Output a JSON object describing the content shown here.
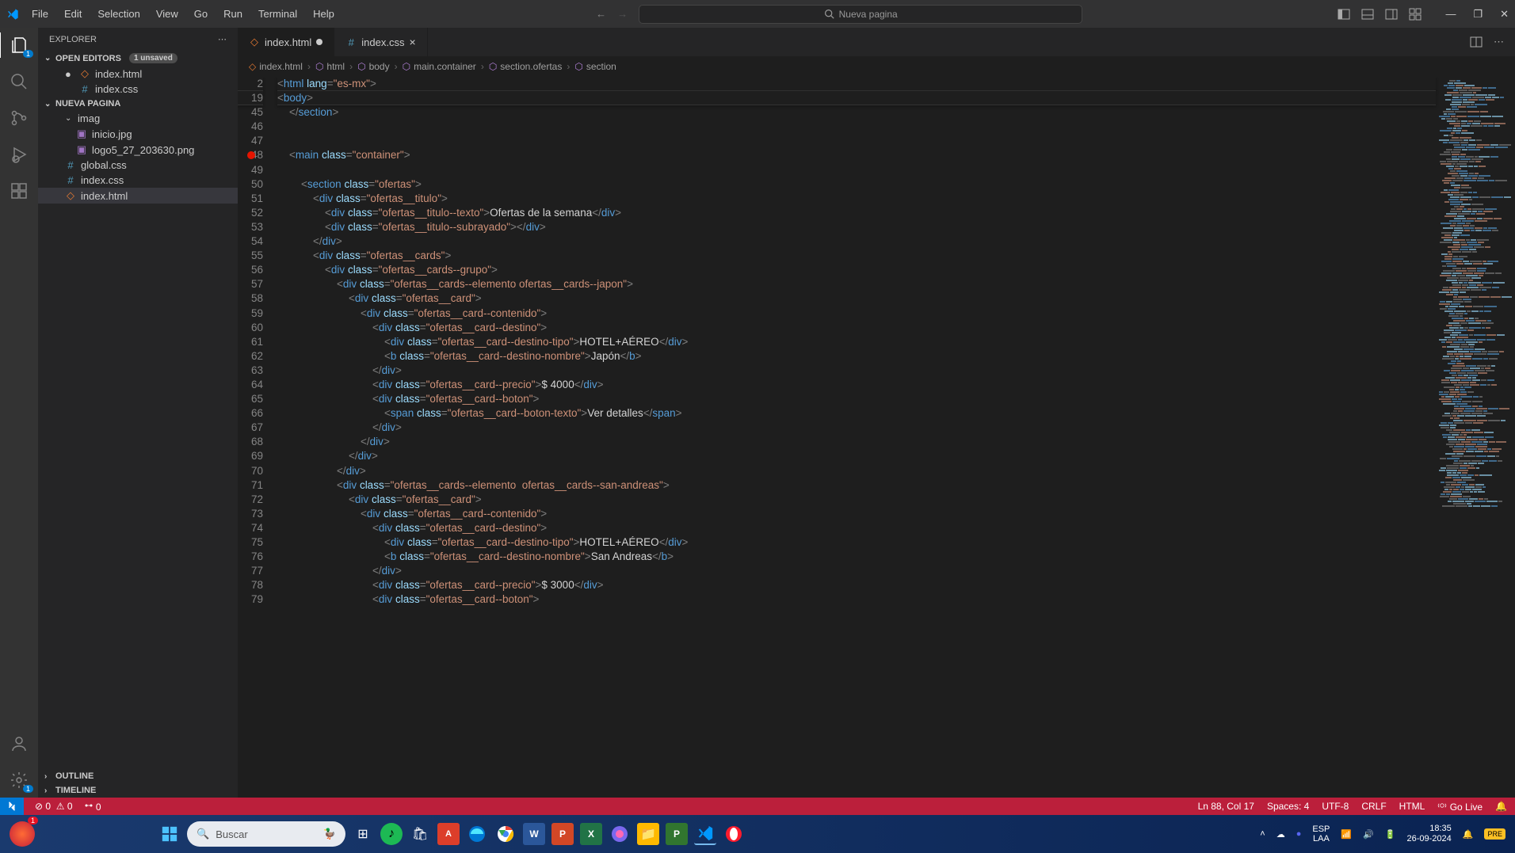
{
  "titlebar": {
    "menus": [
      "File",
      "Edit",
      "Selection",
      "View",
      "Go",
      "Run",
      "Terminal",
      "Help"
    ],
    "search_placeholder": "Nueva pagina"
  },
  "sidebar": {
    "title": "EXPLORER",
    "open_editors_label": "OPEN EDITORS",
    "unsaved_badge": "1 unsaved",
    "open_editors": [
      {
        "name": "index.html",
        "dirty": true,
        "icon": "html"
      },
      {
        "name": "index.css",
        "dirty": false,
        "icon": "css"
      }
    ],
    "workspace_label": "NUEVA PAGINA",
    "tree": {
      "folder_imag": "imag",
      "files_imag": [
        "inicio.jpg",
        "logo5_27_203630.png"
      ],
      "root_files": [
        {
          "name": "global.css",
          "icon": "css"
        },
        {
          "name": "index.css",
          "icon": "css"
        },
        {
          "name": "index.html",
          "icon": "html",
          "selected": true
        }
      ]
    },
    "outline_label": "OUTLINE",
    "timeline_label": "TIMELINE"
  },
  "tabs": [
    {
      "name": "index.html",
      "icon": "html",
      "active": true,
      "dirty": true
    },
    {
      "name": "index.css",
      "icon": "css",
      "active": false,
      "dirty": false
    }
  ],
  "breadcrumb": [
    "index.html",
    "html",
    "body",
    "main.container",
    "section.ofertas",
    "section"
  ],
  "code": {
    "sticky": [
      {
        "num": 2,
        "html": "<span class='t-brack'>&lt;</span><span class='t-tag'>html</span> <span class='t-attr'>lang</span><span class='t-brack'>=</span><span class='t-str'>\"es-mx\"</span><span class='t-brack'>&gt;</span>"
      },
      {
        "num": 19,
        "html": "<span class='t-brack'>&lt;</span><span class='t-tag'>body</span><span class='t-brack'>&gt;</span>"
      }
    ],
    "lines": [
      {
        "num": 45,
        "indent": 4,
        "html": "<span class='t-brack'>&lt;/</span><span class='t-tag'>section</span><span class='t-brack'>&gt;</span>"
      },
      {
        "num": 46,
        "indent": 0,
        "html": ""
      },
      {
        "num": 47,
        "indent": 0,
        "html": ""
      },
      {
        "num": 48,
        "indent": 4,
        "bp": true,
        "html": "<span class='t-brack'>&lt;</span><span class='t-tag'>main</span> <span class='t-attr'>class</span><span class='t-brack'>=</span><span class='t-str'>\"container\"</span><span class='t-brack'>&gt;</span>"
      },
      {
        "num": 49,
        "indent": 0,
        "html": ""
      },
      {
        "num": 50,
        "indent": 8,
        "html": "<span class='t-brack'>&lt;</span><span class='t-tag'>section</span> <span class='t-attr'>class</span><span class='t-brack'>=</span><span class='t-str'>\"ofertas\"</span><span class='t-brack'>&gt;</span>"
      },
      {
        "num": 51,
        "indent": 12,
        "html": "<span class='t-brack'>&lt;</span><span class='t-tag'>div</span> <span class='t-attr'>class</span><span class='t-brack'>=</span><span class='t-str'>\"ofertas__titulo\"</span><span class='t-brack'>&gt;</span>"
      },
      {
        "num": 52,
        "indent": 16,
        "html": "<span class='t-brack'>&lt;</span><span class='t-tag'>div</span> <span class='t-attr'>class</span><span class='t-brack'>=</span><span class='t-str'>\"ofertas__titulo--texto\"</span><span class='t-brack'>&gt;</span><span class='t-txt'>Ofertas de la semana</span><span class='t-brack'>&lt;/</span><span class='t-tag'>div</span><span class='t-brack'>&gt;</span>"
      },
      {
        "num": 53,
        "indent": 16,
        "html": "<span class='t-brack'>&lt;</span><span class='t-tag'>div</span> <span class='t-attr'>class</span><span class='t-brack'>=</span><span class='t-str'>\"ofertas__titulo--subrayado\"</span><span class='t-brack'>&gt;&lt;/</span><span class='t-tag'>div</span><span class='t-brack'>&gt;</span>"
      },
      {
        "num": 54,
        "indent": 12,
        "html": "<span class='t-brack'>&lt;/</span><span class='t-tag'>div</span><span class='t-brack'>&gt;</span>"
      },
      {
        "num": 55,
        "indent": 12,
        "html": "<span class='t-brack'>&lt;</span><span class='t-tag'>div</span> <span class='t-attr'>class</span><span class='t-brack'>=</span><span class='t-str'>\"ofertas__cards\"</span><span class='t-brack'>&gt;</span>"
      },
      {
        "num": 56,
        "indent": 16,
        "html": "<span class='t-brack'>&lt;</span><span class='t-tag'>div</span> <span class='t-attr'>class</span><span class='t-brack'>=</span><span class='t-str'>\"ofertas__cards--grupo\"</span><span class='t-brack'>&gt;</span>"
      },
      {
        "num": 57,
        "indent": 20,
        "html": "<span class='t-brack'>&lt;</span><span class='t-tag'>div</span> <span class='t-attr'>class</span><span class='t-brack'>=</span><span class='t-str'>\"ofertas__cards--elemento ofertas__cards--japon\"</span><span class='t-brack'>&gt;</span>"
      },
      {
        "num": 58,
        "indent": 24,
        "html": "<span class='t-brack'>&lt;</span><span class='t-tag'>div</span> <span class='t-attr'>class</span><span class='t-brack'>=</span><span class='t-str'>\"ofertas__card\"</span><span class='t-brack'>&gt;</span>"
      },
      {
        "num": 59,
        "indent": 28,
        "html": "<span class='t-brack'>&lt;</span><span class='t-tag'>div</span> <span class='t-attr'>class</span><span class='t-brack'>=</span><span class='t-str'>\"ofertas__card--contenido\"</span><span class='t-brack'>&gt;</span>"
      },
      {
        "num": 60,
        "indent": 32,
        "html": "<span class='t-brack'>&lt;</span><span class='t-tag'>div</span> <span class='t-attr'>class</span><span class='t-brack'>=</span><span class='t-str'>\"ofertas__card--destino\"</span><span class='t-brack'>&gt;</span>"
      },
      {
        "num": 61,
        "indent": 36,
        "html": "<span class='t-brack'>&lt;</span><span class='t-tag'>div</span> <span class='t-attr'>class</span><span class='t-brack'>=</span><span class='t-str'>\"ofertas__card--destino-tipo\"</span><span class='t-brack'>&gt;</span><span class='t-txt'>HOTEL+AÉREO</span><span class='t-brack'>&lt;/</span><span class='t-tag'>div</span><span class='t-brack'>&gt;</span>"
      },
      {
        "num": 62,
        "indent": 36,
        "html": "<span class='t-brack'>&lt;</span><span class='t-tag'>b</span> <span class='t-attr'>class</span><span class='t-brack'>=</span><span class='t-str'>\"ofertas__card--destino-nombre\"</span><span class='t-brack'>&gt;</span><span class='t-txt'>Japón</span><span class='t-brack'>&lt;/</span><span class='t-tag'>b</span><span class='t-brack'>&gt;</span>"
      },
      {
        "num": 63,
        "indent": 32,
        "html": "<span class='t-brack'>&lt;/</span><span class='t-tag'>div</span><span class='t-brack'>&gt;</span>"
      },
      {
        "num": 64,
        "indent": 32,
        "html": "<span class='t-brack'>&lt;</span><span class='t-tag'>div</span> <span class='t-attr'>class</span><span class='t-brack'>=</span><span class='t-str'>\"ofertas__card--precio\"</span><span class='t-brack'>&gt;</span><span class='t-txt'>$ 4000</span><span class='t-brack'>&lt;/</span><span class='t-tag'>div</span><span class='t-brack'>&gt;</span>"
      },
      {
        "num": 65,
        "indent": 32,
        "html": "<span class='t-brack'>&lt;</span><span class='t-tag'>div</span> <span class='t-attr'>class</span><span class='t-brack'>=</span><span class='t-str'>\"ofertas__card--boton\"</span><span class='t-brack'>&gt;</span>"
      },
      {
        "num": 66,
        "indent": 36,
        "html": "<span class='t-brack'>&lt;</span><span class='t-tag'>span</span> <span class='t-attr'>class</span><span class='t-brack'>=</span><span class='t-str'>\"ofertas__card--boton-texto\"</span><span class='t-brack'>&gt;</span><span class='t-txt'>Ver detalles</span><span class='t-brack'>&lt;/</span><span class='t-tag'>span</span><span class='t-brack'>&gt;</span>"
      },
      {
        "num": 67,
        "indent": 32,
        "html": "<span class='t-brack'>&lt;/</span><span class='t-tag'>div</span><span class='t-brack'>&gt;</span>"
      },
      {
        "num": 68,
        "indent": 28,
        "html": "<span class='t-brack'>&lt;/</span><span class='t-tag'>div</span><span class='t-brack'>&gt;</span>"
      },
      {
        "num": 69,
        "indent": 24,
        "html": "<span class='t-brack'>&lt;/</span><span class='t-tag'>div</span><span class='t-brack'>&gt;</span>"
      },
      {
        "num": 70,
        "indent": 20,
        "html": "<span class='t-brack'>&lt;/</span><span class='t-tag'>div</span><span class='t-brack'>&gt;</span>"
      },
      {
        "num": 71,
        "indent": 20,
        "html": "<span class='t-brack'>&lt;</span><span class='t-tag'>div</span> <span class='t-attr'>class</span><span class='t-brack'>=</span><span class='t-str'>\"ofertas__cards--elemento  ofertas__cards--san-andreas\"</span><span class='t-brack'>&gt;</span>"
      },
      {
        "num": 72,
        "indent": 24,
        "html": "<span class='t-brack'>&lt;</span><span class='t-tag'>div</span> <span class='t-attr'>class</span><span class='t-brack'>=</span><span class='t-str'>\"ofertas__card\"</span><span class='t-brack'>&gt;</span>"
      },
      {
        "num": 73,
        "indent": 28,
        "html": "<span class='t-brack'>&lt;</span><span class='t-tag'>div</span> <span class='t-attr'>class</span><span class='t-brack'>=</span><span class='t-str'>\"ofertas__card--contenido\"</span><span class='t-brack'>&gt;</span>"
      },
      {
        "num": 74,
        "indent": 32,
        "html": "<span class='t-brack'>&lt;</span><span class='t-tag'>div</span> <span class='t-attr'>class</span><span class='t-brack'>=</span><span class='t-str'>\"ofertas__card--destino\"</span><span class='t-brack'>&gt;</span>"
      },
      {
        "num": 75,
        "indent": 36,
        "html": "<span class='t-brack'>&lt;</span><span class='t-tag'>div</span> <span class='t-attr'>class</span><span class='t-brack'>=</span><span class='t-str'>\"ofertas__card--destino-tipo\"</span><span class='t-brack'>&gt;</span><span class='t-txt'>HOTEL+AÉREO</span><span class='t-brack'>&lt;/</span><span class='t-tag'>div</span><span class='t-brack'>&gt;</span>"
      },
      {
        "num": 76,
        "indent": 36,
        "html": "<span class='t-brack'>&lt;</span><span class='t-tag'>b</span> <span class='t-attr'>class</span><span class='t-brack'>=</span><span class='t-str'>\"ofertas__card--destino-nombre\"</span><span class='t-brack'>&gt;</span><span class='t-txt'>San Andreas</span><span class='t-brack'>&lt;/</span><span class='t-tag'>b</span><span class='t-brack'>&gt;</span>"
      },
      {
        "num": 77,
        "indent": 32,
        "html": "<span class='t-brack'>&lt;/</span><span class='t-tag'>div</span><span class='t-brack'>&gt;</span>"
      },
      {
        "num": 78,
        "indent": 32,
        "html": "<span class='t-brack'>&lt;</span><span class='t-tag'>div</span> <span class='t-attr'>class</span><span class='t-brack'>=</span><span class='t-str'>\"ofertas__card--precio\"</span><span class='t-brack'>&gt;</span><span class='t-txt'>$ 3000</span><span class='t-brack'>&lt;/</span><span class='t-tag'>div</span><span class='t-brack'>&gt;</span>"
      },
      {
        "num": 79,
        "indent": 32,
        "html": "<span class='t-brack'>&lt;</span><span class='t-tag'>div</span> <span class='t-attr'>class</span><span class='t-brack'>=</span><span class='t-str'>\"ofertas__card--boton\"</span><span class='t-brack'>&gt;</span>"
      }
    ]
  },
  "statusbar": {
    "errors": "0",
    "warnings": "0",
    "ports": "0",
    "cursor": "Ln 88, Col 17",
    "spaces": "Spaces: 4",
    "encoding": "UTF-8",
    "eol": "CRLF",
    "lang": "HTML",
    "golive": "Go Live"
  },
  "taskbar": {
    "search_placeholder": "Buscar",
    "lang": "ESP",
    "lang2": "LAA",
    "time": "18:35",
    "date": "26-09-2024"
  }
}
